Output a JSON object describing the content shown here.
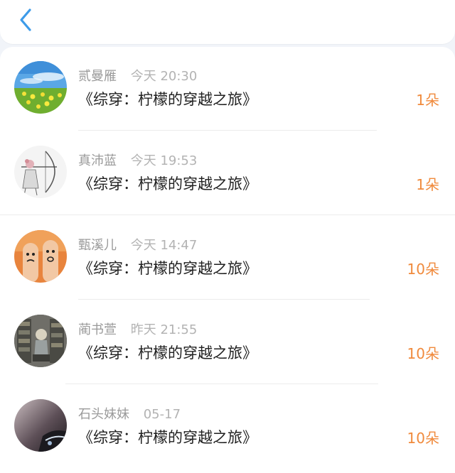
{
  "topbar": {
    "back_icon": "chevron-left-icon",
    "accent_color": "#3d9be9"
  },
  "records": [
    {
      "name": "贰曼雁",
      "time": "今天 20:30",
      "title": "《综穿：柠檬的穿越之旅》",
      "amount": "1朵",
      "avatar": "landscape-flowers-avatar"
    },
    {
      "name": "真沛蓝",
      "time": "今天 19:53",
      "title": "《综穿：柠檬的穿越之旅》",
      "amount": "1朵",
      "avatar": "archer-girl-avatar"
    },
    {
      "name": "甄溪儿",
      "time": "今天 14:47",
      "title": "《综穿：柠檬的穿越之旅》",
      "amount": "10朵",
      "avatar": "finger-faces-avatar"
    },
    {
      "name": "蔺书萱",
      "time": "昨天 21:55",
      "title": "《综穿：柠檬的穿越之旅》",
      "amount": "10朵",
      "avatar": "anime-library-avatar"
    },
    {
      "name": "石头妹妹",
      "time": "05-17",
      "title": "《综穿：柠檬的穿越之旅》",
      "amount": "10朵",
      "avatar": "dark-photo-avatar"
    }
  ],
  "colors": {
    "amount": "#f08a3c",
    "name": "#9a9a9a",
    "title": "#1f1f1f",
    "background": "#f1f4f9"
  }
}
